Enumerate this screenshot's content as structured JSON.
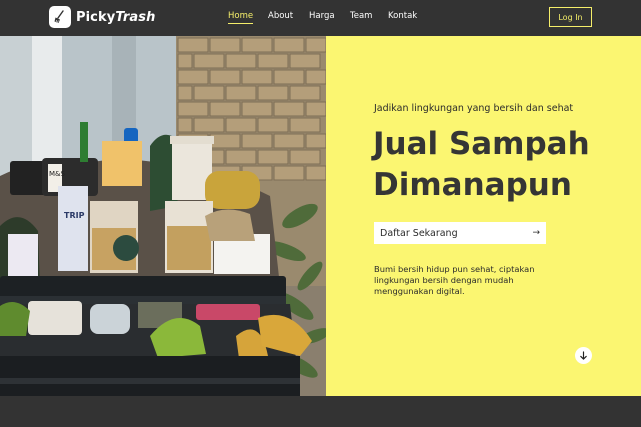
{
  "brand": {
    "name_plain": "Picky",
    "name_accent": "Trash",
    "icon": "broom-logo-icon"
  },
  "nav": {
    "items": [
      {
        "label": "Home",
        "active": true
      },
      {
        "label": "About",
        "active": false
      },
      {
        "label": "Harga",
        "active": false
      },
      {
        "label": "Team",
        "active": false
      },
      {
        "label": "Kontak",
        "active": false
      }
    ],
    "login_label": "Log In"
  },
  "hero": {
    "subtitle": "Jadikan lingkungan yang bersih dan sehat",
    "headline_line1": "Jual Sampah",
    "headline_line2": "Dimanapun",
    "cta_label": "Daftar Sekarang",
    "cta_icon": "arrow-right-icon",
    "description": "Bumi bersih hidup pun sehat, ciptakan lingkungan bersih dengan mudah menggunakan digital.",
    "scroll_icon": "arrow-down-icon",
    "photo_labels": {
      "cup_brand": "TRIP",
      "can_brand": "M&S"
    }
  },
  "colors": {
    "navbar": "#333333",
    "accent_yellow": "#f5ee6a",
    "hero_yellow": "#fbf671",
    "text_dark": "#353535"
  }
}
